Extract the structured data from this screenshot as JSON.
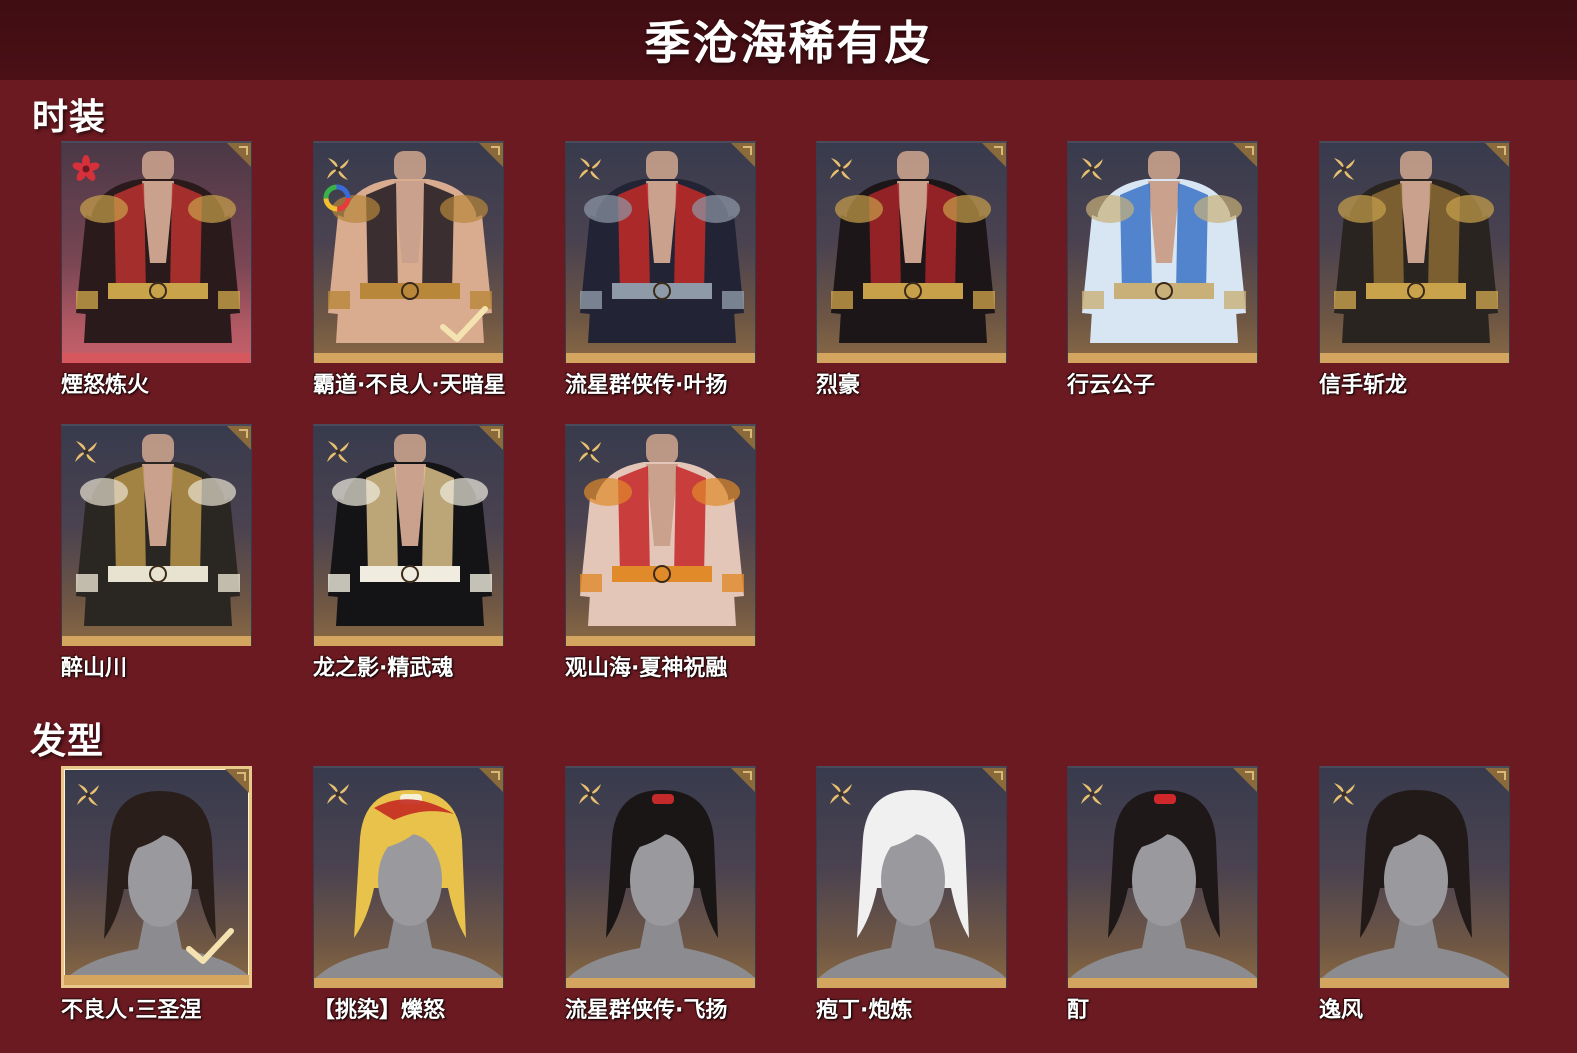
{
  "header": {
    "title": "季沧海稀有皮"
  },
  "sections": {
    "outfits": {
      "title": "时装",
      "items": [
        {
          "name": "煙怒炼火",
          "rarity": "red",
          "rarity_icon": "flower-icon",
          "colors": [
            "#2a1a1c",
            "#b8322e",
            "#c9a34a"
          ]
        },
        {
          "name": "霸道·不良人·天暗星",
          "rarity": "gold",
          "rarity_icon": "star-icon",
          "dye_icon": "color-wheel-icon",
          "owned": true,
          "colors": [
            "#d9ab8f",
            "#1e1820",
            "#b8873a"
          ]
        },
        {
          "name": "流星群侠传·叶扬",
          "rarity": "gold",
          "rarity_icon": "star-icon",
          "colors": [
            "#222436",
            "#c42a28",
            "#8f9aa8"
          ]
        },
        {
          "name": "烈豪",
          "rarity": "gold",
          "rarity_icon": "star-icon",
          "colors": [
            "#1c1618",
            "#a8242a",
            "#c9a04a"
          ]
        },
        {
          "name": "行云公子",
          "rarity": "gold",
          "rarity_icon": "star-icon",
          "colors": [
            "#d8e6f4",
            "#3a72c4",
            "#c9b078"
          ]
        },
        {
          "name": "信手斩龙",
          "rarity": "gold",
          "rarity_icon": "star-icon",
          "colors": [
            "#2a2420",
            "#8a6a34",
            "#c9a24c"
          ]
        },
        {
          "name": "醉山川",
          "rarity": "gold",
          "rarity_icon": "star-icon",
          "colors": [
            "#2a2622",
            "#b8944a",
            "#e8e2d0"
          ]
        },
        {
          "name": "龙之影·精武魂",
          "rarity": "gold",
          "rarity_icon": "star-icon",
          "colors": [
            "#141416",
            "#d9c08a",
            "#f0ece0"
          ]
        },
        {
          "name": "观山海·夏神祝融",
          "rarity": "gold",
          "rarity_icon": "star-icon",
          "colors": [
            "#e4c6b8",
            "#c42626",
            "#e08a2a"
          ]
        }
      ]
    },
    "hairstyles": {
      "title": "发型",
      "items": [
        {
          "name": "不良人·三圣涅",
          "rarity": "gold",
          "rarity_icon": "star-icon",
          "selected": true,
          "owned": true,
          "colors": [
            "#2a1e1a"
          ]
        },
        {
          "name": "【挑染】爍怒",
          "rarity": "gold",
          "rarity_icon": "star-icon",
          "colors": [
            "#e8c24a",
            "#f6f0d8",
            "#c42a22"
          ]
        },
        {
          "name": "流星群侠传·飞扬",
          "rarity": "gold",
          "rarity_icon": "star-icon",
          "colors": [
            "#1a1616",
            "#c42a2a"
          ]
        },
        {
          "name": "疱丁·炮炼",
          "rarity": "gold",
          "rarity_icon": "star-icon",
          "colors": [
            "#f0f0f0"
          ]
        },
        {
          "name": "酊",
          "rarity": "gold",
          "rarity_icon": "star-icon",
          "colors": [
            "#1e1818",
            "#d0282a"
          ]
        },
        {
          "name": "逸风",
          "rarity": "gold",
          "rarity_icon": "star-icon",
          "colors": [
            "#221a18"
          ]
        }
      ]
    }
  },
  "theme": {
    "background": "#6a1a20",
    "header_bg": "#4a1016",
    "gold_accent": "#d4a55e",
    "red_accent": "#d6585e"
  }
}
